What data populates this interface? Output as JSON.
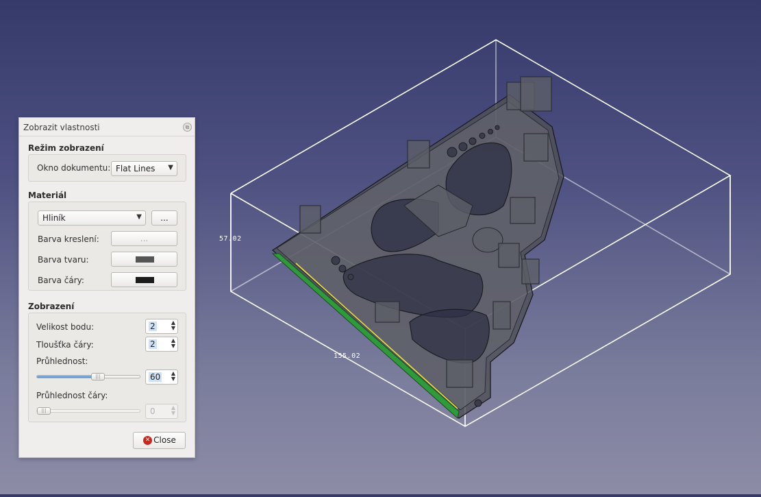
{
  "viewport": {
    "dimension_height": "57.02",
    "dimension_width": "155.02",
    "colors": {
      "background_top": "#363a6a",
      "background_bottom": "#8c8ca6",
      "bounding_box": "#ffffff",
      "model": "#5c5e66",
      "selected_edge": "#2f9a3c",
      "highlight_line": "#f0e040"
    }
  },
  "dialog": {
    "title": "Zobrazit vlastnosti",
    "float_icon": "float-window-icon",
    "display_mode": {
      "section_title": "Režim zobrazení",
      "document_window_label": "Okno dokumentu:",
      "document_window_value": "Flat Lines"
    },
    "material": {
      "section_title": "Materiál",
      "material_value": "Hliník",
      "more_button": "...",
      "draw_color_label": "Barva kreslení:",
      "draw_color_button": "...",
      "shape_color_label": "Barva tvaru:",
      "shape_color": "#555555",
      "line_color_label": "Barva čáry:",
      "line_color": "#1c1c1c"
    },
    "display": {
      "section_title": "Zobrazení",
      "point_size_label": "Velikost bodu:",
      "point_size": "2",
      "line_width_label": "Tloušťka čáry:",
      "line_width": "2",
      "transparency_label": "Průhlednost:",
      "transparency": "60",
      "transparency_fraction": 0.6,
      "line_transparency_label": "Průhlednost čáry:",
      "line_transparency": "0",
      "line_transparency_fraction": 0
    },
    "close_label": "Close",
    "close_icon": "close-icon"
  }
}
